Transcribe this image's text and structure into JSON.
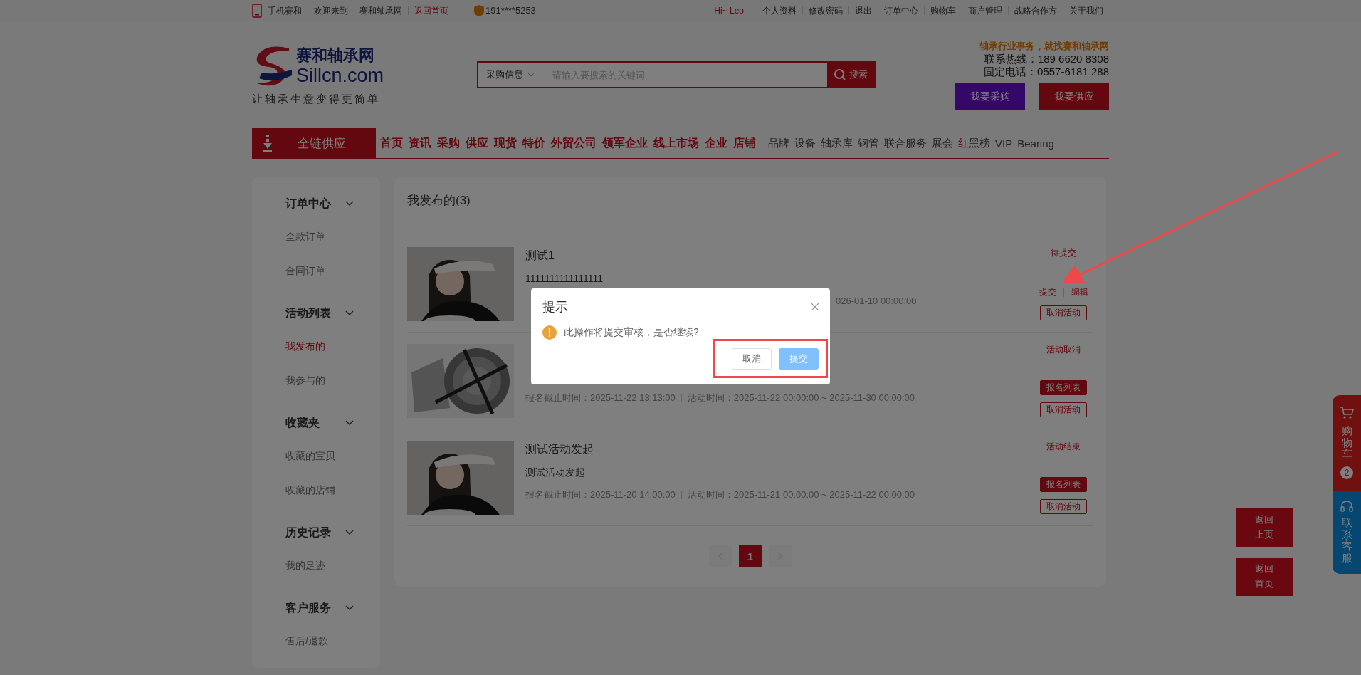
{
  "top_bar": {
    "mobile": "手机赛和",
    "welcome": "欢迎来到",
    "site": "赛和轴承网",
    "home_link": "返回首页",
    "phone": "191****5253",
    "greeting": "Hi~ Leo",
    "links": [
      "个人资料",
      "修改密码",
      "退出",
      "订单中心",
      "购物车",
      "商户管理",
      "战略合作方",
      "关于我们"
    ]
  },
  "header": {
    "logo": {
      "name": "赛和轴承网",
      "domain": "Sillcn.com",
      "slogan": "让轴承生意变得更简单"
    },
    "search": {
      "category": "采购信息",
      "placeholder": "请输入要搜索的关键词",
      "button": "搜索"
    },
    "contact": {
      "tagline": "轴承行业事务，就找赛和轴承网",
      "hotline": "联系热线：189 6620 8308",
      "landline": "固定电话：0557-6181 288"
    },
    "buttons": [
      {
        "label": "我要采购",
        "kind": "buy"
      },
      {
        "label": "我要供应",
        "kind": "supply"
      }
    ]
  },
  "nav": {
    "featured": "全链供应",
    "primary": [
      "首页",
      "资讯",
      "采购",
      "供应",
      "现货",
      "特价",
      "外贸公司",
      "领军企业",
      "线上市场",
      "企业",
      "店铺"
    ],
    "secondary": [
      {
        "label": "品牌"
      },
      {
        "label": "设备"
      },
      {
        "label": "轴承库"
      },
      {
        "label": "钢管"
      },
      {
        "label": "联合服务"
      },
      {
        "label": "展会"
      },
      {
        "accent": "红",
        "label": "黑榜"
      },
      {
        "label": "VIP"
      },
      {
        "label": "Bearing"
      }
    ]
  },
  "sidebar": {
    "groups": [
      {
        "title": "订单中心",
        "expanded": true,
        "items": [
          {
            "label": "全款订单",
            "selected": false
          },
          {
            "label": "合同订单",
            "selected": false
          }
        ]
      },
      {
        "title": "活动列表",
        "expanded": true,
        "items": [
          {
            "label": "我发布的",
            "selected": true
          },
          {
            "label": "我参与的",
            "selected": false
          }
        ]
      },
      {
        "title": "收藏夹",
        "expanded": true,
        "items": [
          {
            "label": "收藏的宝贝",
            "selected": false
          },
          {
            "label": "收藏的店铺",
            "selected": false
          }
        ]
      },
      {
        "title": "历史记录",
        "expanded": true,
        "items": [
          {
            "label": "我的足迹",
            "selected": false
          }
        ]
      },
      {
        "title": "客户服务",
        "expanded": true,
        "items": [
          {
            "label": "售后/退款",
            "selected": false
          }
        ]
      }
    ]
  },
  "content": {
    "title": "我发布的(3)",
    "activities": [
      {
        "title": "测试1",
        "description": "1111111111111111",
        "meta": {
          "kind": "partial",
          "end": "026-01-10 00:00:00"
        },
        "status": "待提交",
        "actions": [
          {
            "kind": "link",
            "label": "提交"
          },
          {
            "kind": "link",
            "label": "编辑"
          },
          {
            "kind": "outline",
            "label": "取消活动"
          }
        ]
      },
      {
        "meta": {
          "kind": "full",
          "deadline": "报名截止时间：2025-11-22 13:13:00",
          "time": "活动时间：2025-11-22 00:00:00 ~ 2025-11-30 00:00:00"
        },
        "status": "活动取消",
        "actions": [
          {
            "kind": "filled",
            "label": "报名列表"
          },
          {
            "kind": "outline",
            "label": "取消活动"
          }
        ]
      },
      {
        "title": "测试活动发起",
        "description": "测试活动发起",
        "meta": {
          "kind": "full",
          "deadline": "报名截止时间：2025-11-20 14:00:00",
          "time": "活动时间：2025-11-21 00:00:00 ~ 2025-11-22 00:00:00"
        },
        "status": "活动结束",
        "actions": [
          {
            "kind": "filled",
            "label": "报名列表"
          },
          {
            "kind": "outline",
            "label": "取消活动"
          }
        ]
      }
    ],
    "pagination": [
      {
        "kind": "prev",
        "disabled": true
      },
      {
        "kind": "page",
        "label": "1",
        "selected": true
      },
      {
        "kind": "next",
        "disabled": true
      }
    ]
  },
  "floating": {
    "cart": {
      "label": "购物车",
      "count": "2"
    },
    "service": "联系客服",
    "back": [
      "返回上页",
      "返回首页"
    ]
  },
  "dialog": {
    "title": "提示",
    "message": "此操作将提交审核，是否继续?",
    "buttons": [
      {
        "kind": "default",
        "label": "取消"
      },
      {
        "kind": "primary",
        "label": "提交"
      }
    ]
  }
}
